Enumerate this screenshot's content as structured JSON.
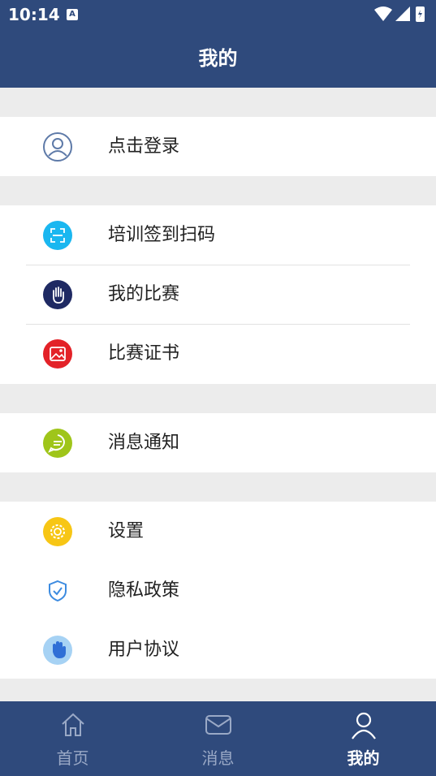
{
  "status_bar": {
    "time": "10:14",
    "badge": "A"
  },
  "header": {
    "title": "我的"
  },
  "login": {
    "label": "点击登录"
  },
  "menu": {
    "scan": "培训签到扫码",
    "my_match": "我的比赛",
    "certificate": "比赛证书",
    "notice": "消息通知",
    "settings": "设置",
    "privacy": "隐私政策",
    "agreement": "用户协议"
  },
  "tabs": {
    "home": "首页",
    "messages": "消息",
    "mine": "我的"
  },
  "colors": {
    "primary": "#2f4a7c",
    "scan": "#1ab7f0",
    "my_match": "#1f2a63",
    "certificate": "#e32228",
    "notice": "#9fc51a",
    "settings": "#f7c615",
    "privacy": "#3c8be0",
    "agreement": "#a6d2f4"
  }
}
